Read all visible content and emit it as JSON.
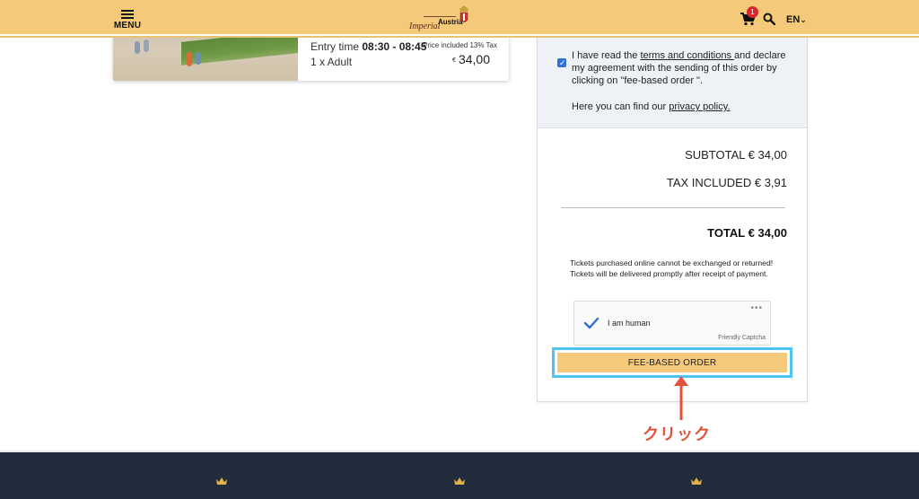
{
  "header": {
    "menu_label": "MENU",
    "logo_imperial": "Imperial",
    "logo_austria": "Austria",
    "cart_count": "1",
    "language": "EN"
  },
  "ticket": {
    "entry_time_label": "Entry time",
    "entry_time_value": "08:30 - 08:45",
    "tax_note": "Price included 13% Tax",
    "quantity": "1 x Adult",
    "currency": "€",
    "price": "34,00"
  },
  "terms": {
    "prefix": "I have read the ",
    "link": "terms and conditions ",
    "suffix": "and declare my agreement with the sending of this order by clicking on \"fee-based order \".",
    "privacy_prefix": "Here you can find our ",
    "privacy_link": "privacy policy."
  },
  "totals": {
    "subtotal": "SUBTOTAL € 34,00",
    "tax": "TAX INCLUDED € 3,91",
    "total": "TOTAL € 34,00"
  },
  "notice": {
    "line1": "Tickets purchased online cannot be exchanged or returned!",
    "line2": "Tickets will be delivered promptly after receipt of payment."
  },
  "captcha": {
    "label": "I am human",
    "brand": "Friendly Captcha",
    "dots": "•••"
  },
  "order_button_label": "FEE-BASED ORDER",
  "annotation_label": "クリック",
  "colors": {
    "header_bg": "#f5c97a",
    "button_bg": "#f5c97a",
    "highlight_border": "#4cc3f0",
    "annotation": "#e2523a",
    "footer_bg": "#232c3d",
    "checkbox": "#2f6fd6",
    "badge": "#d7272b"
  }
}
